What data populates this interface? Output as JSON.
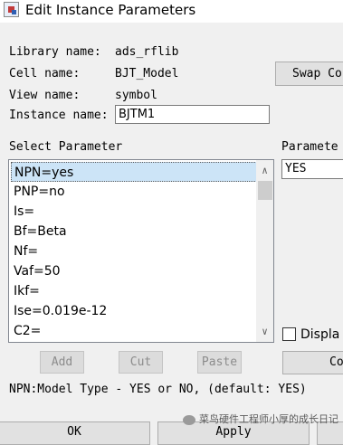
{
  "window": {
    "title": "Edit Instance Parameters"
  },
  "fields": {
    "library_label": "Library name:",
    "library_value": "ads_rflib",
    "cell_label": "Cell name:",
    "cell_value": "BJT_Model",
    "view_label": "View name:",
    "view_value": "symbol",
    "instance_label": "Instance name:",
    "instance_value": "BJTM1"
  },
  "buttons": {
    "swap": "Swap Co",
    "add": "Add",
    "cut": "Cut",
    "paste": "Paste",
    "component": "Co",
    "ok": "OK",
    "apply": "Apply"
  },
  "select_param": {
    "label": "Select Parameter",
    "items": [
      "NPN=yes",
      "PNP=no",
      "Is=",
      "Bf=Beta",
      "Nf=",
      "Vaf=50",
      "Ikf=",
      "Ise=0.019e-12",
      "C2="
    ],
    "selected_index": 0
  },
  "param_entry": {
    "label": "Paramete",
    "value": "YES"
  },
  "display_checkbox": {
    "label": "Displa",
    "checked": false
  },
  "help_text": "NPN:Model Type - YES or NO, (default: YES)",
  "watermark": "菜鸟硬件工程师小厚的成长日记"
}
